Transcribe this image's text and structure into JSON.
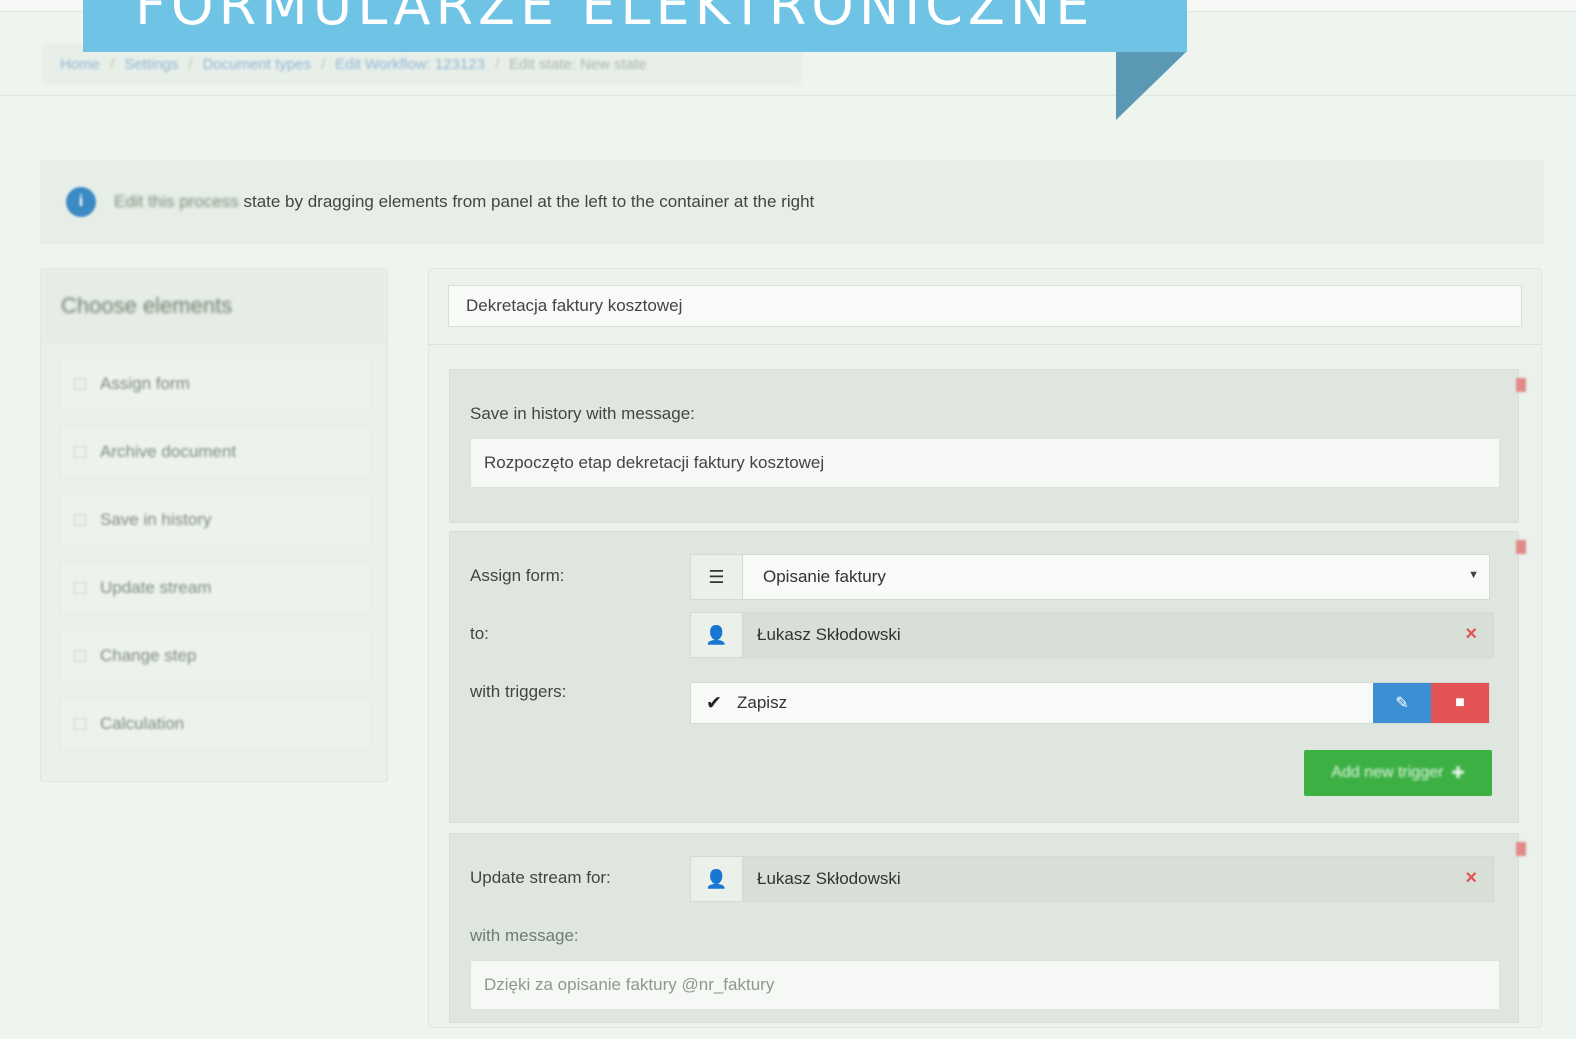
{
  "banner": {
    "title": "FORMULARZE ELEKTRONICZNE"
  },
  "breadcrumb": {
    "items": [
      "Home",
      "Settings",
      "Document types",
      "Edit Workflow: 123123",
      "Edit state: New state"
    ],
    "separator": "/"
  },
  "info": {
    "icon": "info-icon",
    "text_faded": "Edit this process",
    "text": "state by dragging elements from panel at the left to the container at the right"
  },
  "left_panel": {
    "title": "Choose elements",
    "items": [
      "Assign form",
      "Archive document",
      "Save in history",
      "Update stream",
      "Change step",
      "Calculation"
    ]
  },
  "state": {
    "title_value": "Dekretacja faktury kosztowej",
    "history_card": {
      "label": "Save in history with message:",
      "message_value": "Rozpoczęto etap dekretacji faktury kosztowej"
    },
    "assign_card": {
      "assign_label": "Assign form:",
      "form_value": "Opisanie faktury",
      "to_label": "to:",
      "assignee": "Łukasz Skłodowski",
      "triggers_label": "with triggers:",
      "triggers": [
        "Zapisz"
      ],
      "add_trigger_label": "Add new trigger"
    },
    "update_card": {
      "label": "Update stream for:",
      "user": "Łukasz Skłodowski",
      "message_label": "with message:",
      "message_value": "Dzięki za opisanie faktury @nr_faktury"
    }
  },
  "colors": {
    "banner": "#6fc3e4",
    "primary": "#3d8fd4",
    "danger": "#e35353",
    "success": "#3cb043"
  }
}
